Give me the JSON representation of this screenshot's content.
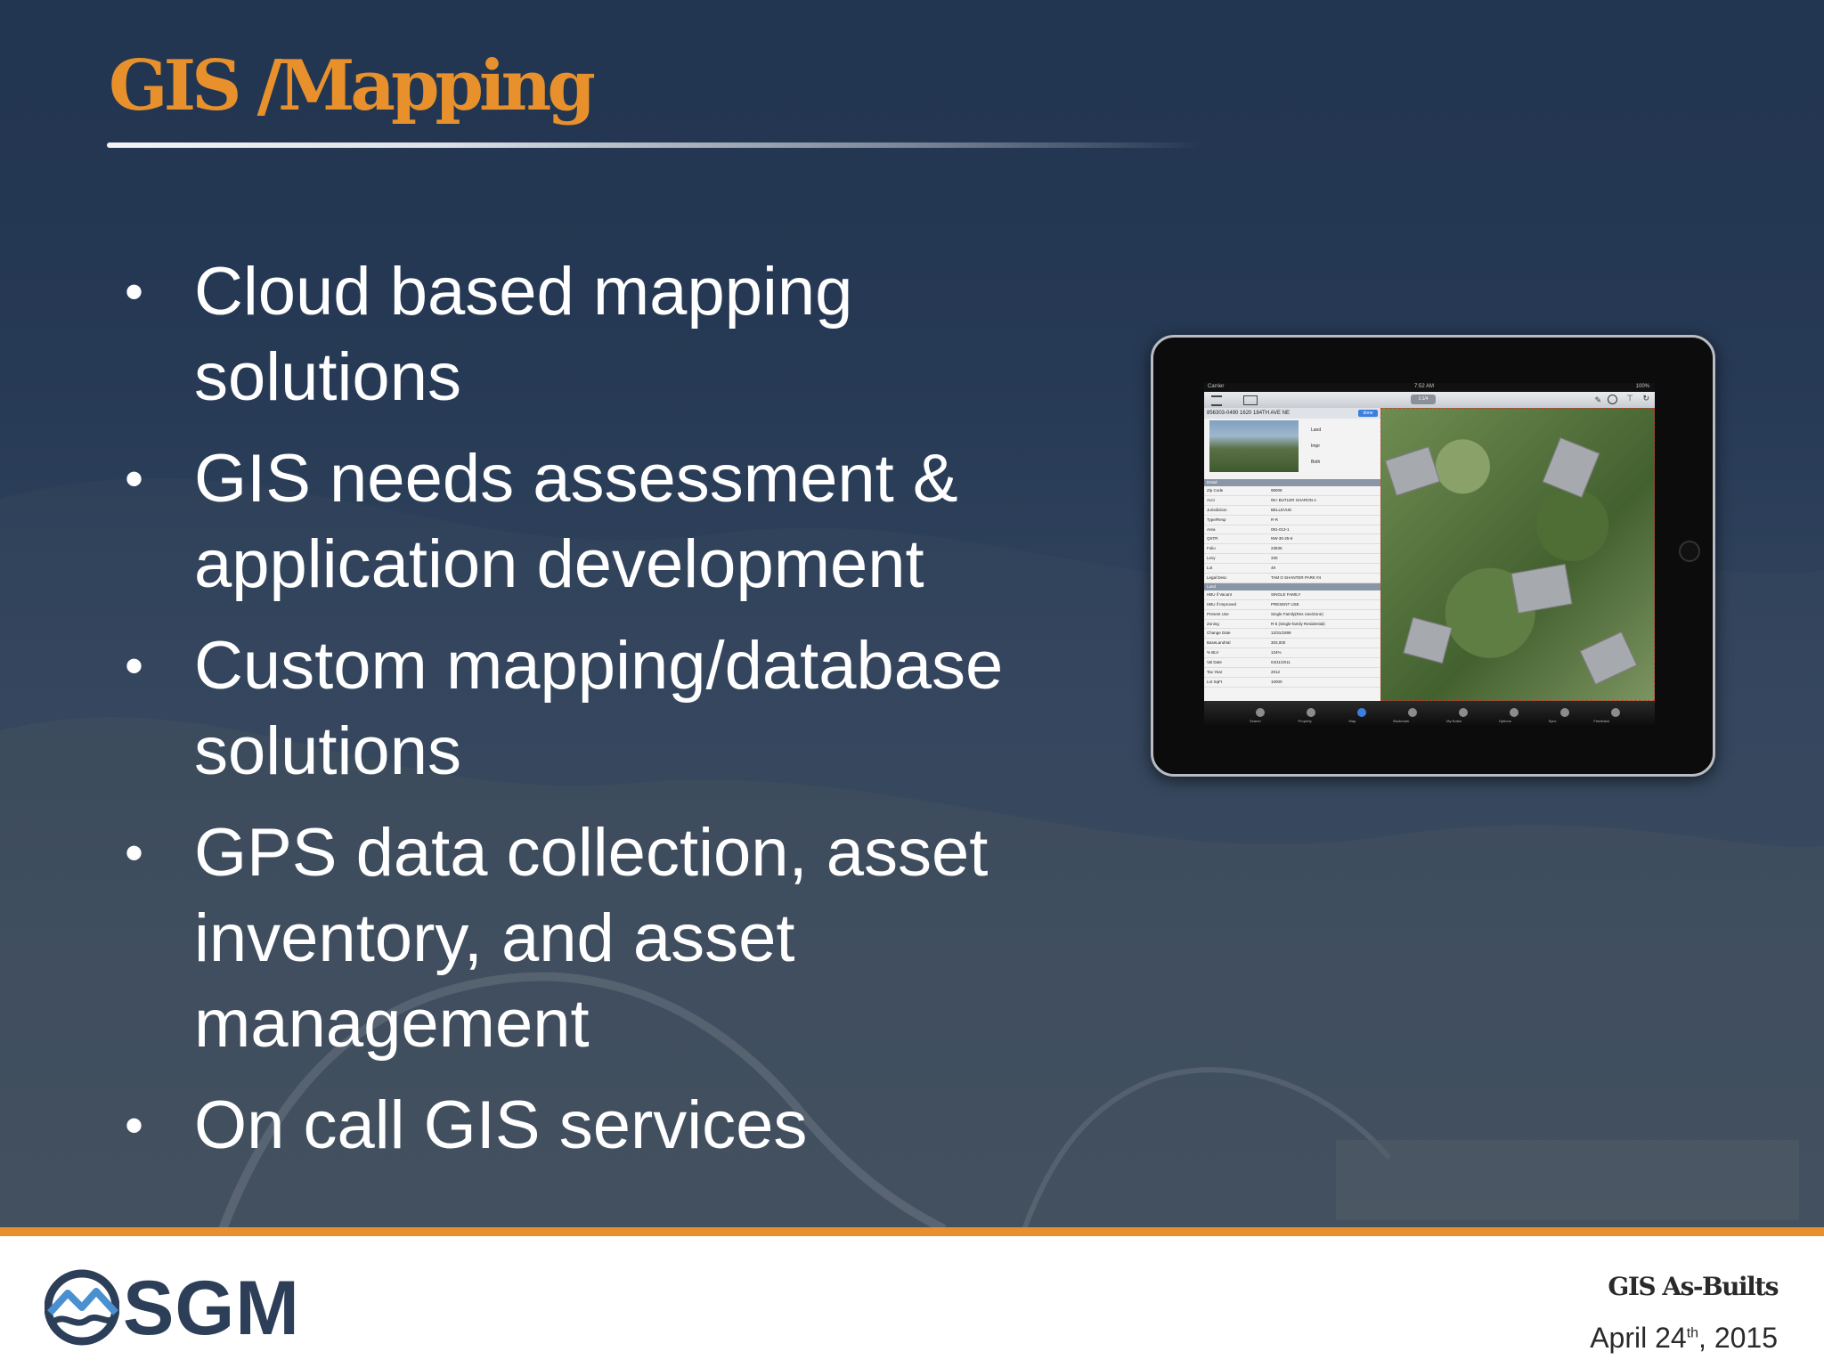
{
  "slide": {
    "title": "GIS /Mapping",
    "bullets": [
      "Cloud based mapping solutions",
      "GIS needs assessment & application development",
      "Custom mapping/database solutions",
      "GPS data collection, asset inventory, and asset management",
      "On call GIS services"
    ],
    "bullet_glyph": "•"
  },
  "footer": {
    "logo_text": "SGM",
    "logo_icon": "sgm-mountain-wave-icon",
    "doc_title": "GIS As-Builts",
    "date_main": "April 24",
    "date_sup": "th",
    "date_year": ", 2015"
  },
  "tablet_screen": {
    "status_carrier": "Carrier",
    "status_time": "7:52 AM",
    "status_battery": "100%",
    "title_pill": "1:1/4",
    "parcel_header": "856303-0490  1620  184TH AVE NE",
    "done_label": "done",
    "toggles": [
      "Land",
      "Impr",
      "Both"
    ],
    "section_detail": "Detail",
    "detail_rows": [
      [
        "Zip Code",
        "98008"
      ],
      [
        "Acct",
        "06 I BUTLER SHARON A"
      ],
      [
        "Jurisdiction",
        "BELLEVUE"
      ],
      [
        "Type/Resp",
        "R-R"
      ],
      [
        "Area",
        "091-013-1"
      ],
      [
        "QSTR",
        "NW-30-25-6"
      ],
      [
        "Folio",
        "23836"
      ],
      [
        "Levy",
        "330"
      ],
      [
        "Lot",
        "49"
      ],
      [
        "Legal Desc",
        "TAM O SHANTER PARK #4"
      ]
    ],
    "section_land": "Land",
    "land_rows": [
      [
        "HBU if Vacant",
        "SINGLE FAMILY"
      ],
      [
        "HBU if Improved",
        "PRESENT USE"
      ],
      [
        "Present Use",
        "Single Family(Res Use/Zone)"
      ],
      [
        "Zoning",
        "R-5 (Single-family Residential)"
      ],
      [
        "Change Date",
        "12/31/1899"
      ],
      [
        "BaseLandVal",
        "303,000"
      ],
      [
        "% BLV",
        "124%"
      ],
      [
        "Val Date",
        "04/11/2011"
      ],
      [
        "Tax Year",
        "2012"
      ],
      [
        "Lot SqFt",
        "10000"
      ]
    ],
    "tabs": [
      "Search",
      "Property",
      "Map",
      "Bookmark",
      "My Notes",
      "Options",
      "Sync",
      "Feedback"
    ]
  },
  "colors": {
    "title_orange": "#e8912c",
    "accent_bar": "#e8902f",
    "slide_bg_top": "#233651",
    "logo_blue": "#2d3f58"
  }
}
